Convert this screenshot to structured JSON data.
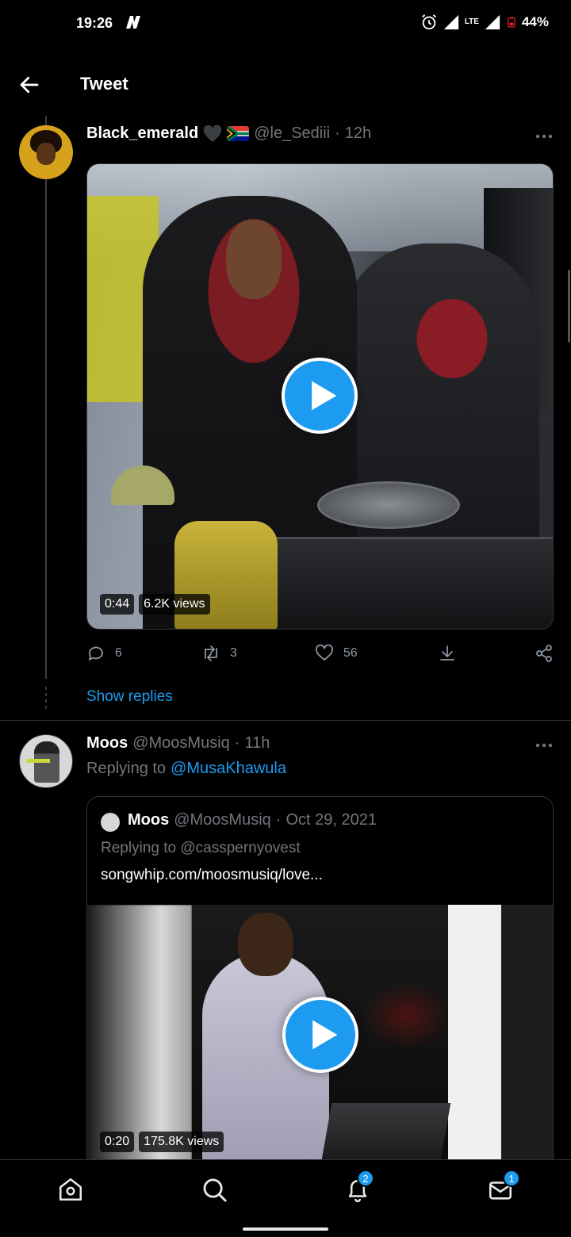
{
  "status_bar": {
    "time": "19:26",
    "network": "LTE",
    "battery": "44%"
  },
  "header": {
    "title": "Tweet"
  },
  "tweet1": {
    "name": "Black_emerald",
    "handle": "@le_Sediii",
    "separator": "·",
    "time": "12h",
    "video": {
      "duration": "0:44",
      "views": "6.2K views"
    },
    "actions": {
      "replies": "6",
      "retweets": "3",
      "likes": "56"
    },
    "show_replies": "Show replies"
  },
  "tweet2": {
    "name": "Moos",
    "handle": "@MoosMusiq",
    "separator": "·",
    "time": "11h",
    "replying_prefix": "Replying to",
    "replying_to": "@MusaKhawula",
    "quote": {
      "name": "Moos",
      "handle": "@MoosMusiq",
      "separator": "·",
      "date": "Oct 29, 2021",
      "replying": "Replying to @casspernyovest",
      "link": "songwhip.com/moosmusiq/love...",
      "video": {
        "duration": "0:20",
        "views": "175.8K views"
      }
    }
  },
  "bottom_nav": {
    "notifications_badge": "2",
    "messages_badge": "1"
  },
  "icons": [
    "back-arrow-icon",
    "more-icon",
    "play-icon",
    "reply-icon",
    "retweet-icon",
    "like-icon",
    "download-icon",
    "share-icon",
    "home-icon",
    "search-icon",
    "bell-icon",
    "mail-icon"
  ],
  "colors": {
    "accent": "#1d9bf0",
    "background": "#000000",
    "muted": "#71767b"
  }
}
